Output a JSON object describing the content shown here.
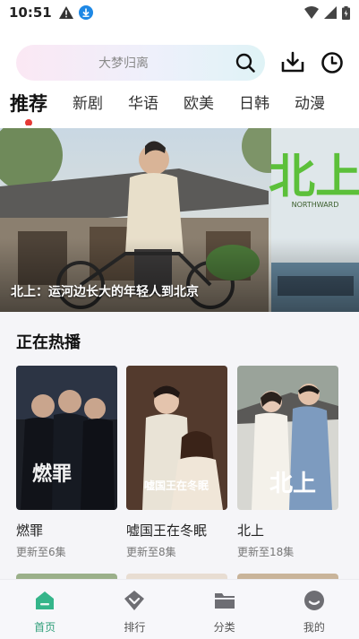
{
  "status_bar": {
    "time": "10:51"
  },
  "search": {
    "placeholder": "大梦归离"
  },
  "tabs": [
    {
      "label": "推荐",
      "active": true
    },
    {
      "label": "新剧",
      "active": false
    },
    {
      "label": "华语",
      "active": false
    },
    {
      "label": "欧美",
      "active": false
    },
    {
      "label": "日韩",
      "active": false
    },
    {
      "label": "动漫",
      "active": false
    }
  ],
  "banner": {
    "caption": "北上：运河边长大的年轻人到北京",
    "poster_calligraphy": "北上",
    "poster_small_text": "NORTHWARD"
  },
  "now_playing": {
    "title": "正在热播",
    "items": [
      {
        "title": "燃罪",
        "subtitle": "更新至6集",
        "poster_text": "燃罪"
      },
      {
        "title": "嘘国王在冬眠",
        "subtitle": "更新至8集",
        "poster_text": "嘘国王在冬眠"
      },
      {
        "title": "北上",
        "subtitle": "更新至18集",
        "poster_text": "北上"
      }
    ]
  },
  "bottom_nav": [
    {
      "label": "首页",
      "icon": "home-icon",
      "active": true
    },
    {
      "label": "排行",
      "icon": "ranking-icon",
      "active": false
    },
    {
      "label": "分类",
      "icon": "category-folder-icon",
      "active": false
    },
    {
      "label": "我的",
      "icon": "profile-icon",
      "active": false
    }
  ],
  "colors": {
    "accent": "#2e9e78",
    "tab_indicator": "#e53935"
  }
}
